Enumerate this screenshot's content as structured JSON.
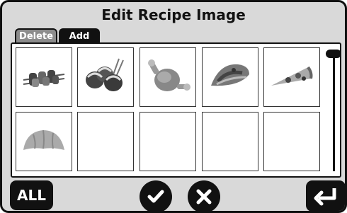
{
  "header": {
    "title": "Edit Recipe Image"
  },
  "tabs": [
    {
      "label": "Delete",
      "active": false
    },
    {
      "label": "Add",
      "active": true
    }
  ],
  "grid": {
    "items": [
      {
        "icon": "kebab-icon",
        "filled": true
      },
      {
        "icon": "takoyaki-icon",
        "filled": true
      },
      {
        "icon": "chicken-drumstick-icon",
        "filled": true
      },
      {
        "icon": "taco-icon",
        "filled": true
      },
      {
        "icon": "pizza-slice-icon",
        "filled": true
      },
      {
        "icon": "croissant-icon",
        "filled": true
      },
      {
        "icon": "",
        "filled": false
      },
      {
        "icon": "",
        "filled": false
      },
      {
        "icon": "",
        "filled": false
      },
      {
        "icon": "",
        "filled": false
      }
    ]
  },
  "scrollbar": {
    "position": 0.0
  },
  "footer": {
    "all_label": "ALL",
    "confirm_icon": "check-icon",
    "cancel_icon": "close-icon",
    "back_icon": "return-arrow-icon"
  },
  "colors": {
    "frame": "#111111",
    "background": "#d9d9d9",
    "panel": "#ffffff",
    "tab_inactive": "#8c8c8c"
  }
}
